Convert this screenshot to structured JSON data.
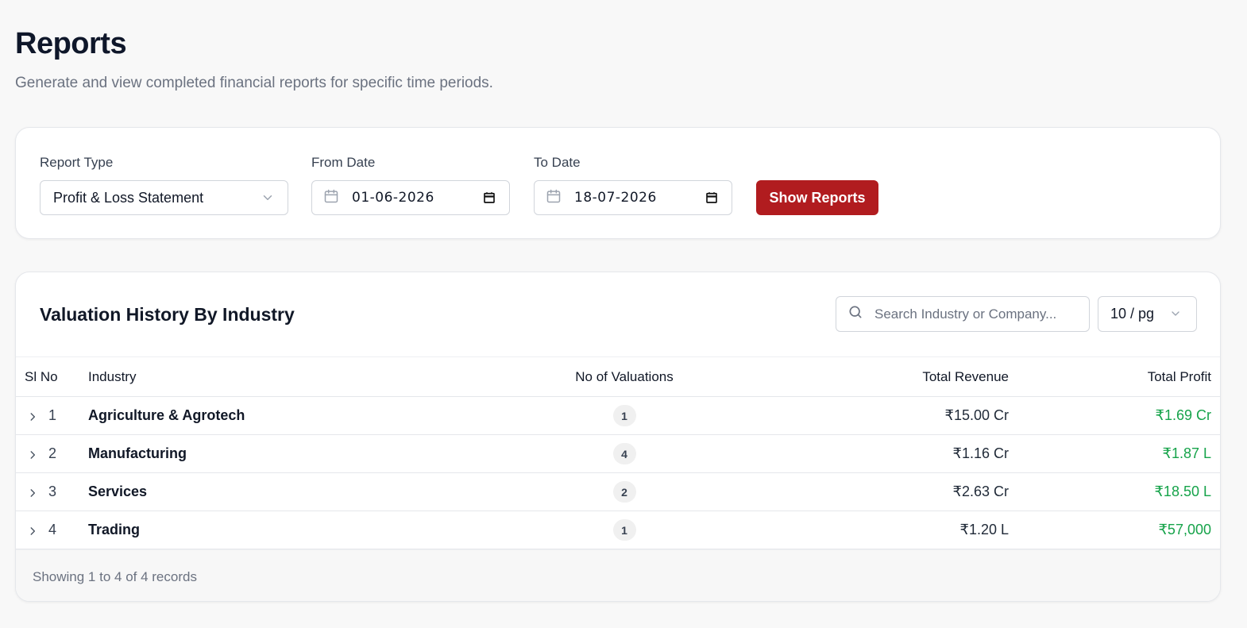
{
  "page": {
    "title": "Reports",
    "subtitle": "Generate and view completed financial reports for specific time periods."
  },
  "filters": {
    "report_type_label": "Report Type",
    "report_type_value": "Profit & Loss Statement",
    "from_date_label": "From Date",
    "from_date_value": "01-06-2026",
    "to_date_label": "To Date",
    "to_date_value": "18-07-2026",
    "show_button": "Show Reports"
  },
  "table": {
    "title": "Valuation History By Industry",
    "search_placeholder": "Search Industry or Company...",
    "page_size": "10 / pg",
    "columns": {
      "sl_no": "Sl No",
      "industry": "Industry",
      "valuations": "No of Valuations",
      "revenue": "Total Revenue",
      "profit": "Total Profit"
    },
    "rows": [
      {
        "sl": "1",
        "industry": "Agriculture & Agrotech",
        "valuations": "1",
        "revenue": "₹15.00 Cr",
        "profit": "₹1.69 Cr"
      },
      {
        "sl": "2",
        "industry": "Manufacturing",
        "valuations": "4",
        "revenue": "₹1.16 Cr",
        "profit": "₹1.87 L"
      },
      {
        "sl": "3",
        "industry": "Services",
        "valuations": "2",
        "revenue": "₹2.63 Cr",
        "profit": "₹18.50 L"
      },
      {
        "sl": "4",
        "industry": "Trading",
        "valuations": "1",
        "revenue": "₹1.20 L",
        "profit": "₹57,000"
      }
    ],
    "footer": "Showing 1 to 4 of 4 records"
  },
  "colors": {
    "primary_button": "#b11c1f",
    "profit_text": "#16a34a",
    "background": "#f8f8f8"
  },
  "icons": [
    "calendar-icon",
    "chevron-down-icon",
    "search-icon",
    "chevron-right-icon",
    "date-picker-icon"
  ]
}
